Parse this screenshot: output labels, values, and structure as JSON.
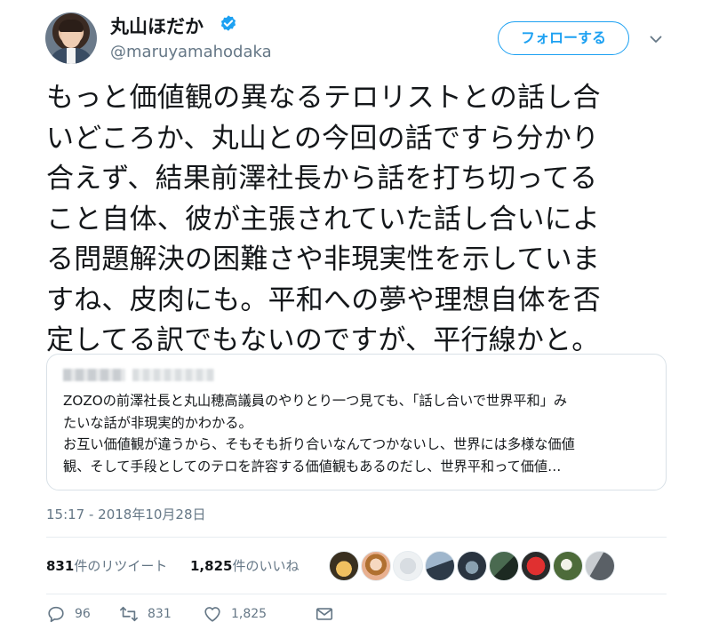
{
  "header": {
    "display_name": "丸山ほだか",
    "handle": "@maruyamahodaka",
    "verified": true,
    "follow_label": "フォローする",
    "accent_color": "#1da1f2"
  },
  "tweet": {
    "lines": [
      "もっと価値観の異なるテロリストとの話し合",
      "いどころか、丸山との今回の話ですら分かり",
      "合えず、結果前澤社長から話を打ち切ってる",
      "こと自体、彼が主張されていた話し合いによ",
      "る問題解決の困難さや非現実性を示していま",
      "すね、皮肉にも。平和への夢や理想自体を否",
      "定してる訳でもないのですが、平行線かと。"
    ]
  },
  "quote": {
    "lines": [
      "ZOZOの前澤社長と丸山穂高議員のやりとり一つ見ても、「話し合いで世界平和」み",
      "たいな話が非現実的かわかる。",
      "お互い価値観が違うから、そもそも折り合いなんてつかないし、世界には多様な価値",
      "観、そして手段としてのテロを許容する価値観もあるのだし、世界平和って価値…"
    ]
  },
  "timestamp": "15:17 - 2018年10月28日",
  "stats": {
    "retweets_count": "831",
    "retweets_label": "件のリツイート",
    "likes_count": "1,825",
    "likes_label": "件のいいね"
  },
  "actions": {
    "reply_count": "96",
    "retweet_count": "831",
    "like_count": "1,825"
  },
  "icons": [
    "verified-badge-icon",
    "chevron-down-icon",
    "reply-icon",
    "retweet-icon",
    "heart-icon",
    "envelope-icon"
  ]
}
